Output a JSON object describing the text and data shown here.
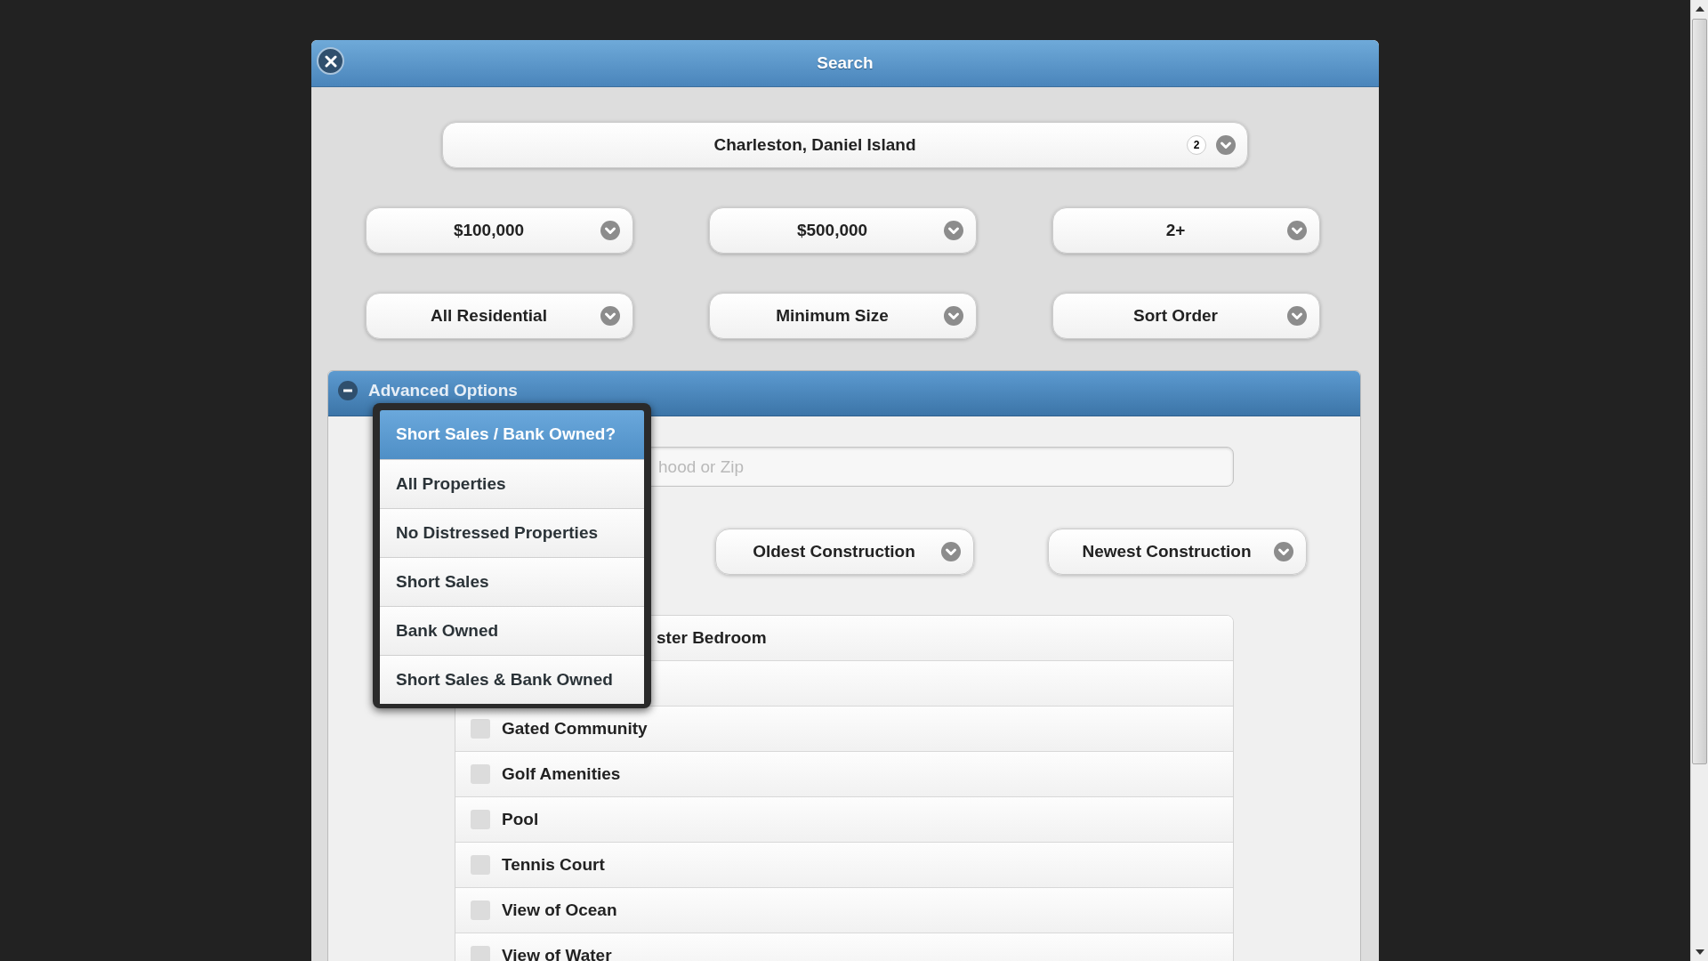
{
  "dialog": {
    "title": "Search"
  },
  "location": {
    "value": "Charleston, Daniel Island",
    "count": "2"
  },
  "filters": [
    {
      "value": "$100,000"
    },
    {
      "value": "$500,000"
    },
    {
      "value": "2+"
    },
    {
      "value": "All Residential"
    },
    {
      "value": "Minimum Size"
    },
    {
      "value": "Sort Order"
    }
  ],
  "advanced": {
    "title": "Advanced Options",
    "expanded": true,
    "search": {
      "placeholder": "hood or Zip"
    },
    "construction": [
      {
        "value": "Oldest Construction"
      },
      {
        "value": "Newest Construction"
      }
    ],
    "features": [
      {
        "kind": "covered",
        "label": "ster Bedroom"
      },
      {
        "kind": "covered"
      },
      {
        "kind": "checkbox",
        "label": "Gated Community",
        "checked": false
      },
      {
        "kind": "checkbox",
        "label": "Golf Amenities",
        "checked": false
      },
      {
        "kind": "checkbox",
        "label": "Pool",
        "checked": false
      },
      {
        "kind": "checkbox",
        "label": "Tennis Court",
        "checked": false
      },
      {
        "kind": "checkbox",
        "label": "View of Ocean",
        "checked": false
      },
      {
        "kind": "checkbox",
        "label": "View of Water",
        "checked": false
      }
    ]
  },
  "popup": {
    "title": "Short Sales / Bank Owned?",
    "options": [
      "All Properties",
      "No Distressed Properties",
      "Short Sales",
      "Bank Owned",
      "Short Sales & Bank Owned"
    ]
  }
}
